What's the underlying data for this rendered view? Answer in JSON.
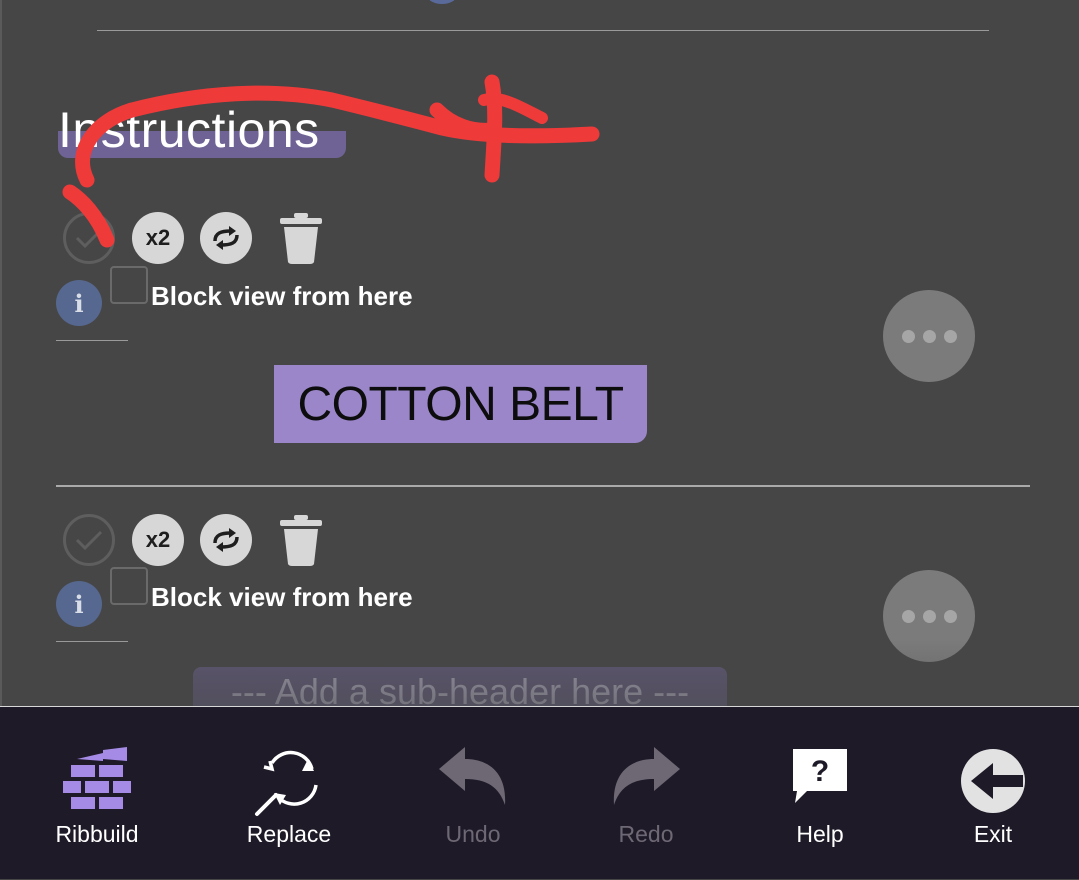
{
  "instructions": {
    "heading": "Instructions"
  },
  "steps": [
    {
      "block_label": "Block view from here",
      "x2_label": "x2",
      "info_glyph": "i"
    },
    {
      "block_label": "Block view from here",
      "x2_label": "x2",
      "info_glyph": "i"
    }
  ],
  "cotton_badge": "COTTON BELT",
  "subheader_placeholder": "--- Add a sub-header here ---",
  "toolbar": {
    "items": [
      {
        "label": "Ribbuild",
        "icon": "brick-trowel-icon",
        "enabled": true
      },
      {
        "label": "Replace",
        "icon": "replace-search-icon",
        "enabled": true
      },
      {
        "label": "Undo",
        "icon": "undo-icon",
        "enabled": false
      },
      {
        "label": "Redo",
        "icon": "redo-icon",
        "enabled": false
      },
      {
        "label": "Help",
        "icon": "help-icon",
        "enabled": true
      },
      {
        "label": "Exit",
        "icon": "exit-icon",
        "enabled": true
      }
    ]
  },
  "colors": {
    "background": "#464646",
    "accent_purple": "#9b86ca",
    "toolbar_bg": "#1f1a28",
    "annotation_red": "#ef3a3a"
  }
}
